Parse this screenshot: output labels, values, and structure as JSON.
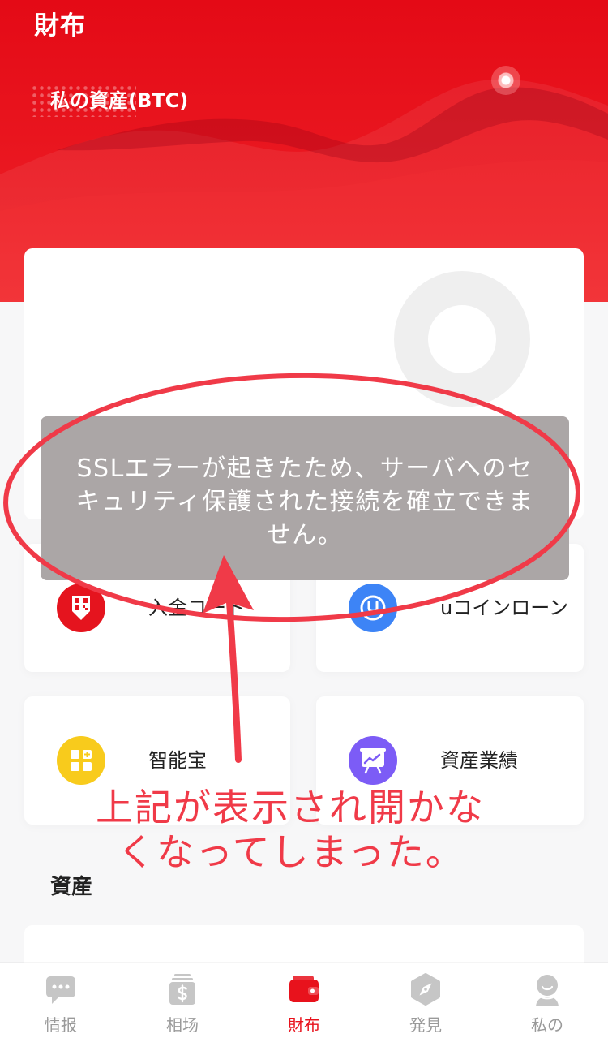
{
  "header": {
    "title": "財布",
    "asset_label": "私の資産(BTC)"
  },
  "toast": {
    "lines": [
      "SSLエラーが起きたため、サーバへのセ",
      "キュリティ保護された接続を確立できま",
      "せん。"
    ]
  },
  "shortcuts": [
    {
      "label": "入金コード",
      "icon": "qr-code-icon",
      "color": "#e5141e"
    },
    {
      "label": "uコインローン",
      "icon": "u-coin-icon",
      "color": "#3d84f6"
    },
    {
      "label": "智能宝",
      "icon": "grid-icon",
      "color": "#f8cb1c"
    },
    {
      "label": "資産業績",
      "icon": "chart-board-icon",
      "color": "#7c5cf6"
    }
  ],
  "assets_section": {
    "title": "資産"
  },
  "tabbar": {
    "active_color": "#e8121c",
    "inactive_icon_color": "#c6c6c6",
    "inactive_label_color": "#9a9a9a",
    "items": [
      {
        "label": "情报",
        "icon": "message-icon",
        "active": false
      },
      {
        "label": "相场",
        "icon": "dollar-icon",
        "active": false
      },
      {
        "label": "財布",
        "icon": "wallet-icon",
        "active": true
      },
      {
        "label": "発見",
        "icon": "compass-icon",
        "active": false
      },
      {
        "label": "私の",
        "icon": "profile-icon",
        "active": false
      }
    ]
  },
  "annotation": {
    "color": "#f03a48",
    "lines": [
      "上記が表示され開かな",
      "くなってしまった。"
    ]
  },
  "theme": {
    "toast_bg": "#aba6a6"
  }
}
